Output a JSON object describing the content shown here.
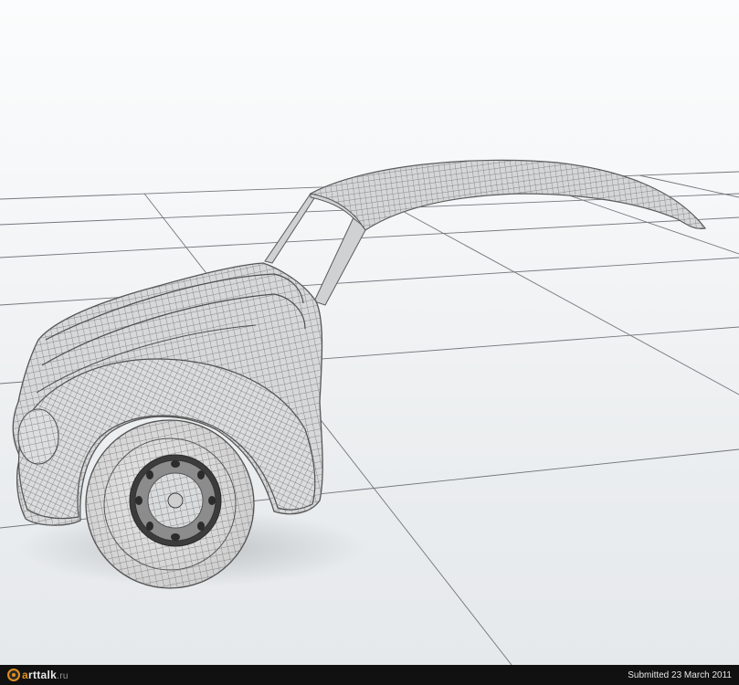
{
  "image": {
    "footer": {
      "logo_text": "arttalk.ru",
      "submitted_text": "Submitted 23 March 2011"
    }
  }
}
